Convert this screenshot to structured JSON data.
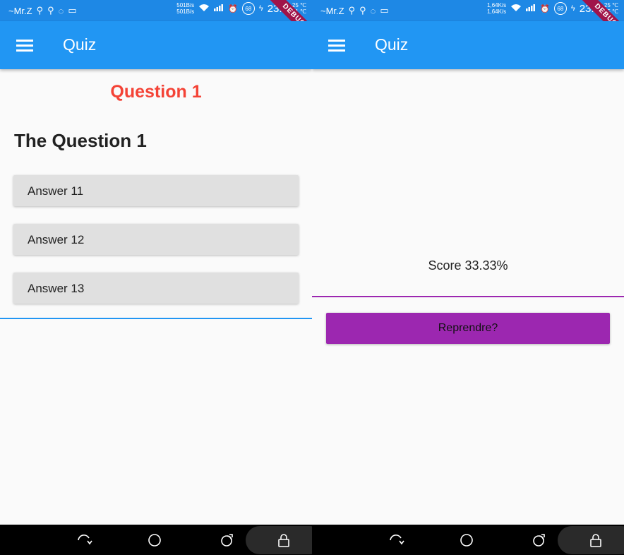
{
  "left_status": {
    "carrier": "~Mr.Z",
    "speed_up": "501B/s",
    "speed_down": "501B/s",
    "battery": "68",
    "time": "23:4",
    "temp1": "25 ℃",
    "temp2": "31 ℃"
  },
  "right_status": {
    "carrier": "~Mr.Z",
    "speed_up": "1,64K/s",
    "speed_down": "1,64K/s",
    "battery": "68",
    "time": "23:4",
    "temp1": "25 ℃",
    "temp2": "35 ℃"
  },
  "debug_label": "DEBUG",
  "app": {
    "title": "Quiz"
  },
  "question": {
    "heading": "Question 1",
    "text": "The Question 1",
    "answers": [
      "Answer 11",
      "Answer 12",
      "Answer 13"
    ]
  },
  "result": {
    "score_text": "Score 33.33%",
    "retry_label": "Reprendre?"
  },
  "icons": {
    "menu": "menu-icon",
    "back": "back-rotate-icon",
    "home": "home-circle-icon",
    "recents": "recents-icon",
    "lock": "lock-icon"
  },
  "colors": {
    "primary": "#2196f3",
    "status_bar": "#1e88e5",
    "question_heading": "#f44336",
    "accent_purple": "#9c27b0",
    "answer_bg": "#e0e0e0"
  }
}
